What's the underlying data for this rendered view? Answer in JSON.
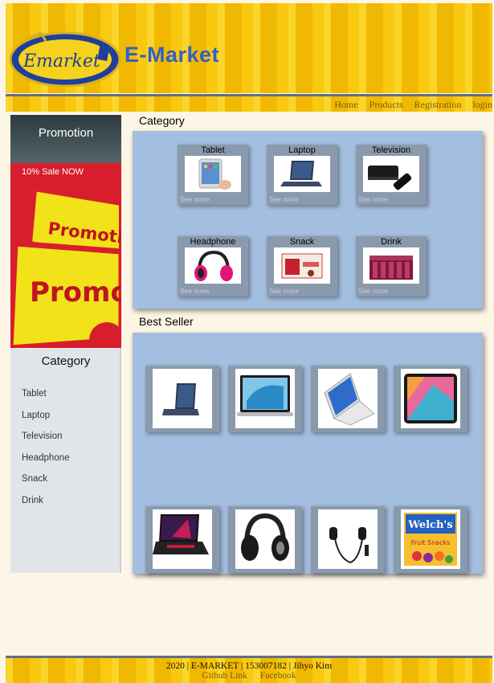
{
  "header": {
    "site_title": "E-Market",
    "logo_text": "Emarket"
  },
  "nav": {
    "items": [
      "Home",
      "Products",
      "Registration",
      "login"
    ]
  },
  "promo": {
    "title": "Promotion",
    "subtitle": "10% Sale NOW",
    "banner_text": [
      "Promotio",
      "Promo"
    ]
  },
  "sidebar": {
    "title": "Category",
    "items": [
      "Tablet",
      "Laptop",
      "Television",
      "Headphone",
      "Snack",
      "Drink"
    ]
  },
  "category_section": {
    "title": "Category",
    "see_more": "See more",
    "cards": [
      {
        "name": "Tablet",
        "icon": "tablet-image"
      },
      {
        "name": "Laptop",
        "icon": "laptop-image"
      },
      {
        "name": "Television",
        "icon": "tv-box-image"
      },
      {
        "name": "Headphone",
        "icon": "headphone-image"
      },
      {
        "name": "Snack",
        "icon": "snack-image"
      },
      {
        "name": "Drink",
        "icon": "drink-image"
      }
    ]
  },
  "best_seller_section": {
    "title": "Best Seller",
    "items": [
      "laptop-image",
      "macbook-image",
      "convertible-laptop-image",
      "android-tablet-image",
      "gaming-laptop-image",
      "over-ear-headphone-image",
      "earphones-image",
      "welchs-fruit-snacks-image"
    ],
    "snack_brand": "Welch's",
    "snack_subtext": "Fruit Snacks"
  },
  "footer": {
    "text": "2020 | E-MARKET | 153007182 | Jihyo Kim",
    "links": [
      "Github Link",
      "Facebook"
    ]
  },
  "colors": {
    "header_yellow": "#f5c000",
    "panel_blue": "#a4bedf",
    "card_gray": "#8a9aad",
    "title_blue": "#3060c8"
  }
}
